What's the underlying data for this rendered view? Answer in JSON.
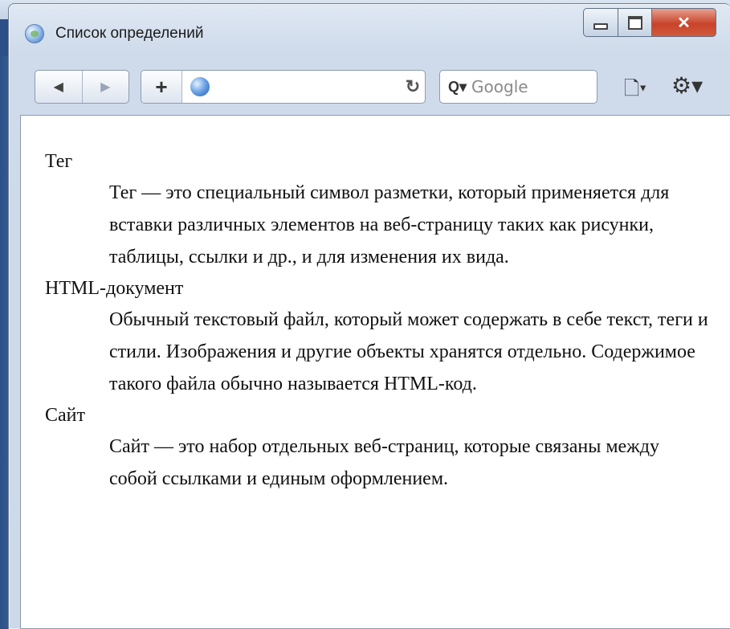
{
  "window": {
    "title": "Список определений"
  },
  "toolbar": {
    "back_glyph": "◀",
    "forward_glyph": "▶",
    "add_glyph": "+",
    "url_value": "",
    "reload_glyph": "↻",
    "search_icon_glyph": "Q▾",
    "search_placeholder": "Google",
    "page_menu_glyph": "🗋▾",
    "tools_menu_glyph": "⚙▾"
  },
  "content": {
    "definitions": [
      {
        "term": "Тег",
        "description": "Тег — это специальный символ разметки, который применяется для вставки различных элементов на веб-страницу таких как рисунки, таблицы, ссылки и др., и для изменения их вида."
      },
      {
        "term": "HTML-документ",
        "description": "Обычный текстовый файл, который может содержать в себе текст, теги и стили. Изображения и другие объекты хранятся отдельно. Содержимое такого файла обычно называется HTML-код."
      },
      {
        "term": "Сайт",
        "description": "Сайт — это набор отдельных веб-страниц, которые связаны между собой ссылками и единым оформлением."
      }
    ]
  },
  "icons": {
    "title_icon": "browser-globe-icon",
    "globe": "globe-icon",
    "reload": "reload-icon",
    "search": "search-icon",
    "page": "page-icon",
    "gear": "gear-icon"
  },
  "colors": {
    "desktop": "#2b4f86",
    "window_frame": "#cfdbeb",
    "close_button": "#c8432a"
  }
}
